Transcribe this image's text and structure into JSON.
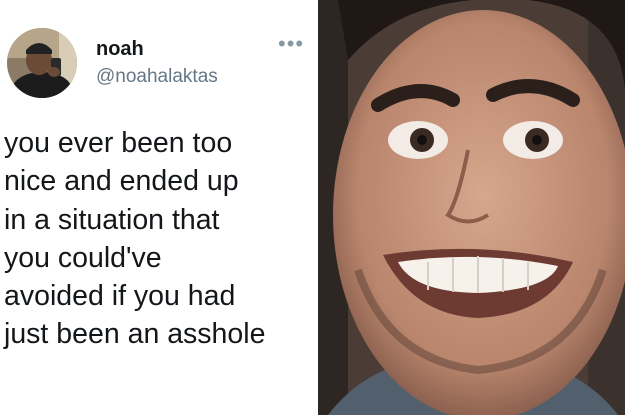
{
  "tweet": {
    "display_name": "noah",
    "handle": "@noahalaktas",
    "more_icon": "more-horizontal-icon",
    "lines": [
      "you ever been too",
      "nice and ended up",
      "in a situation that",
      "you could've",
      "avoided if you had",
      "just been an asshole"
    ]
  },
  "colors": {
    "name": "#14171a",
    "handle": "#657786",
    "icon": "#8899a6"
  }
}
